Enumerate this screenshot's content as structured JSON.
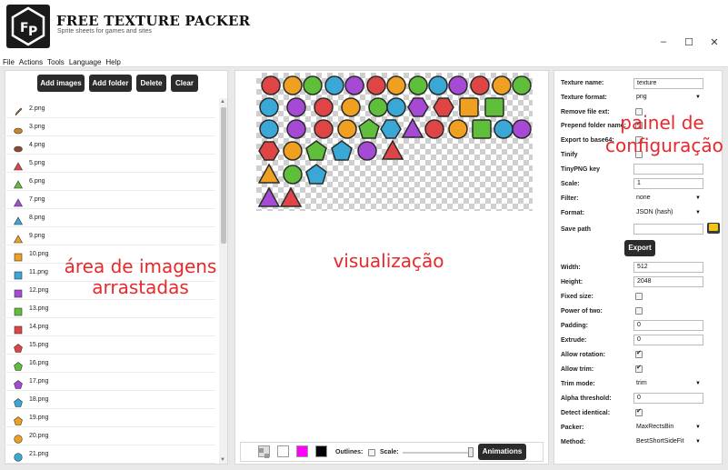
{
  "window": {
    "title": "FREE TEXTURE PACKER",
    "subtitle": "Sprite sheets for games and sites",
    "controls": {
      "minimize": "–",
      "maximize": "☐",
      "close": "✕"
    }
  },
  "menu": [
    "File",
    "Actions",
    "Tools",
    "Language",
    "Help"
  ],
  "left": {
    "buttons": {
      "add_images": "Add images",
      "add_folder": "Add folder",
      "delete": "Delete",
      "clear": "Clear"
    },
    "files": [
      {
        "name": "2.png",
        "icon": "pencil-icon",
        "color": "#b5651d"
      },
      {
        "name": "3.png",
        "icon": "burger-icon",
        "color": "#c8842c"
      },
      {
        "name": "4.png",
        "icon": "cake-icon",
        "color": "#8b4a2b"
      },
      {
        "name": "5.png",
        "icon": "triangle-icon",
        "color": "#e04545"
      },
      {
        "name": "6.png",
        "icon": "triangle-icon",
        "color": "#5fbf3a"
      },
      {
        "name": "7.png",
        "icon": "triangle-icon",
        "color": "#a64ad6"
      },
      {
        "name": "8.png",
        "icon": "triangle-icon",
        "color": "#3aa8d6"
      },
      {
        "name": "9.png",
        "icon": "triangle-icon",
        "color": "#f0a020"
      },
      {
        "name": "10.png",
        "icon": "square-icon",
        "color": "#f0a020"
      },
      {
        "name": "11.png",
        "icon": "square-icon",
        "color": "#3aa8d6"
      },
      {
        "name": "12.png",
        "icon": "square-icon",
        "color": "#a64ad6"
      },
      {
        "name": "13.png",
        "icon": "square-icon",
        "color": "#5fbf3a"
      },
      {
        "name": "14.png",
        "icon": "square-icon",
        "color": "#e04545"
      },
      {
        "name": "15.png",
        "icon": "pentagon-icon",
        "color": "#e04545"
      },
      {
        "name": "16.png",
        "icon": "pentagon-icon",
        "color": "#5fbf3a"
      },
      {
        "name": "17.png",
        "icon": "pentagon-icon",
        "color": "#a64ad6"
      },
      {
        "name": "18.png",
        "icon": "pentagon-icon",
        "color": "#3aa8d6"
      },
      {
        "name": "19.png",
        "icon": "pentagon-icon",
        "color": "#f0a020"
      },
      {
        "name": "20.png",
        "icon": "circle-icon",
        "color": "#f0a020"
      },
      {
        "name": "21.png",
        "icon": "circle-icon",
        "color": "#3aa8d6"
      }
    ],
    "annotation": "área de imagens\narrastadas"
  },
  "center": {
    "annotation": "visualização",
    "outlines_label": "Outlines:",
    "scale_label": "Scale:",
    "animations_button": "Animations",
    "swatch_colors": [
      "#ffffff",
      "#ff00ff",
      "#000000"
    ]
  },
  "right": {
    "annotation": "painel de\nconfiguração",
    "texture_name": {
      "label": "Texture name:",
      "value": "texture"
    },
    "texture_format": {
      "label": "Texture format:",
      "value": "png"
    },
    "remove_file_ext": {
      "label": "Remove file ext:",
      "checked": false
    },
    "prepend_folder_name": {
      "label": "Prepend folder name:",
      "checked": true
    },
    "export_to_base64": {
      "label": "Export to base64:",
      "checked": false
    },
    "tinify": {
      "label": "Tinify",
      "checked": false
    },
    "tinypng_key": {
      "label": "TinyPNG key",
      "value": ""
    },
    "scale": {
      "label": "Scale:",
      "value": "1"
    },
    "filter": {
      "label": "Filter:",
      "value": "none"
    },
    "format": {
      "label": "Format:",
      "value": "JSON (hash)"
    },
    "save_path": {
      "label": "Save path",
      "value": ""
    },
    "export_button": "Export",
    "width": {
      "label": "Width:",
      "value": "512"
    },
    "height": {
      "label": "Height:",
      "value": "2048"
    },
    "fixed_size": {
      "label": "Fixed size:",
      "checked": false
    },
    "power_of_two": {
      "label": "Power of two:",
      "checked": false
    },
    "padding": {
      "label": "Padding:",
      "value": "0"
    },
    "extrude": {
      "label": "Extrude:",
      "value": "0"
    },
    "allow_rotation": {
      "label": "Allow rotation:",
      "checked": true
    },
    "allow_trim": {
      "label": "Allow trim:",
      "checked": true
    },
    "trim_mode": {
      "label": "Trim mode:",
      "value": "trim"
    },
    "alpha_threshold": {
      "label": "Alpha threshold:",
      "value": "0"
    },
    "detect_identical": {
      "label": "Detect identical:",
      "checked": true
    },
    "packer": {
      "label": "Packer:",
      "value": "MaxRectsBin"
    },
    "method": {
      "label": "Method:",
      "value": "BestShortSideFit"
    }
  }
}
